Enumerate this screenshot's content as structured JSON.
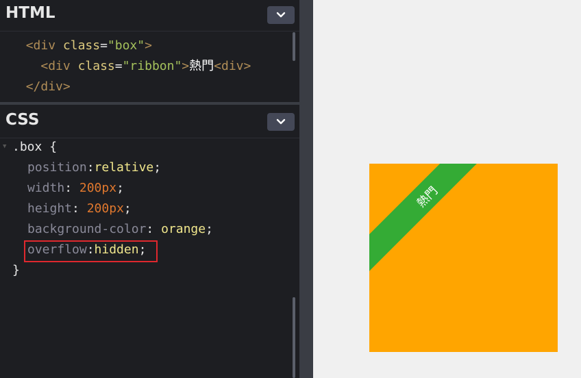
{
  "html_pane": {
    "title": "HTML",
    "lines": [
      {
        "indent": "  ",
        "open": "<div",
        "attr": "class",
        "eq": "=",
        "val": "\"box\"",
        "close": ">"
      },
      {
        "indent": "    ",
        "open": "<div",
        "attr": "class",
        "eq": "=",
        "val": "\"ribbon\"",
        "close": ">",
        "text": "熱門",
        "tail": "<div>"
      },
      {
        "indent": "  ",
        "closing": "</div>"
      }
    ]
  },
  "css_pane": {
    "title": "CSS",
    "selector": ".box",
    "open_brace": "{",
    "close_brace": "}",
    "declarations": [
      {
        "prop": "position",
        "sep": ":",
        "value": "relative",
        "end": ";"
      },
      {
        "prop": "width",
        "sep": ": ",
        "value": "200px",
        "end": ";"
      },
      {
        "prop": "height",
        "sep": ": ",
        "value": "200px",
        "end": ";"
      },
      {
        "prop": "background-color",
        "sep": ": ",
        "value": "orange",
        "end": ";"
      },
      {
        "prop": "overflow",
        "sep": ":",
        "value": "hidden",
        "end": ";"
      }
    ]
  },
  "preview": {
    "ribbon_text": "熱門",
    "box_color": "#ffa500",
    "ribbon_color": "#34ab35"
  },
  "colors": {
    "editor_bg": "#1d1e22",
    "highlight": "#e0282e"
  },
  "icons": {
    "collapse": "chevron-down-icon",
    "fold": "fold-triangle-icon"
  }
}
